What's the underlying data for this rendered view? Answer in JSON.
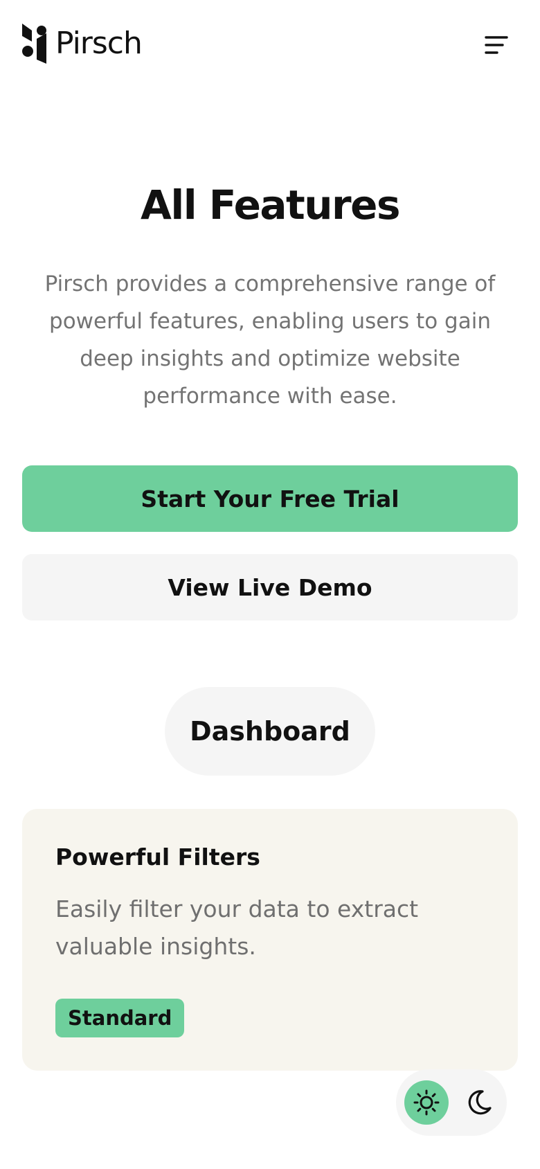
{
  "header": {
    "brand": "Pirsch",
    "logo_icon": "pirsch-logo-icon",
    "menu_icon": "hamburger-menu-icon"
  },
  "hero": {
    "title": "All Features",
    "description": "Pirsch provides a comprehensive range of powerful features, enabling users to gain deep insights and optimize website performance with ease."
  },
  "actions": {
    "primary_label": "Start Your Free Trial",
    "secondary_label": "View Live Demo"
  },
  "category": {
    "label": "Dashboard"
  },
  "feature_card": {
    "title": "Powerful Filters",
    "description": "Easily filter your data to extract valuable insights.",
    "badge": "Standard"
  },
  "theme_toggle": {
    "light_icon": "sun-icon",
    "dark_icon": "moon-icon",
    "active": "light"
  },
  "colors": {
    "accent": "#6ecf9c",
    "text": "#111111",
    "muted_text": "#737373",
    "surface": "#f5f5f5",
    "card_background": "#f7f5ee"
  }
}
